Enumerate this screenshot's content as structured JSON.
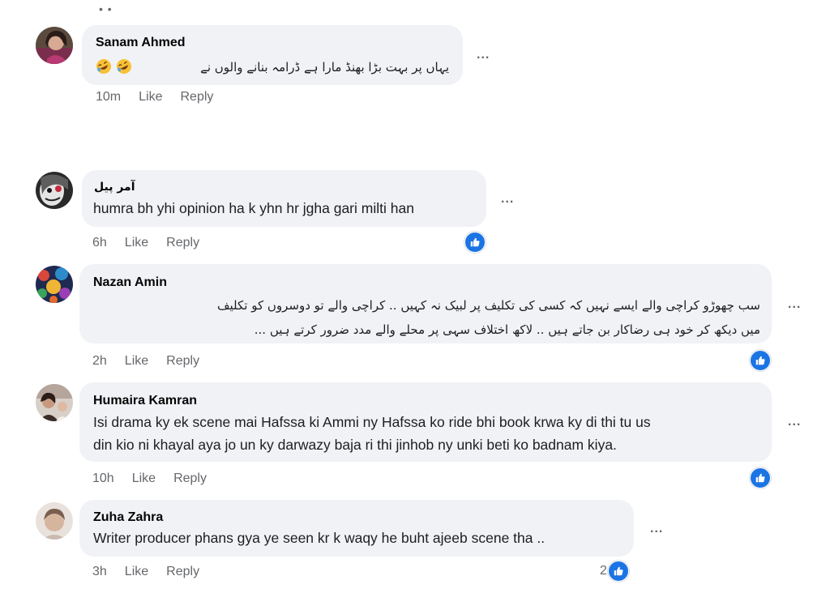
{
  "comments": [
    {
      "author": "Sanam Ahmed",
      "text": "یہاں پر بہت بڑا بھنڈ مارا ہے ڈرامہ بنانے والوں نے",
      "emojis": [
        "rolling-on-floor-laughing-icon",
        "rolling-on-floor-laughing-icon"
      ],
      "time": "10m",
      "like_label": "Like",
      "reply_label": "Reply"
    },
    {
      "author": "آمر پیل",
      "text": "humra bh yhi opinion ha k yhn hr jgha gari milti han",
      "time": "6h",
      "like_label": "Like",
      "reply_label": "Reply",
      "reaction": "like"
    },
    {
      "author": "Nazan Amin",
      "text_lines": [
        "سب چھوڑو کراچی والے ایسے نہیں کہ کسی کی تکلیف پر لبیک نہ کہیں .. کراچی والے تو دوسروں کو تکلیف",
        "میں دیکھ کر خود ہی رضاکار بن جاتے ہیں .. لاکھ اختلاف سہی پر محلے والے مدد ضرور کرتے ہیں ..."
      ],
      "time": "2h",
      "like_label": "Like",
      "reply_label": "Reply",
      "reaction": "like"
    },
    {
      "author": "Humaira Kamran",
      "text_lines": [
        "Isi drama ky ek scene mai Hafssa ki Ammi ny Hafssa ko ride bhi book krwa ky di thi tu us",
        "din kio ni khayal aya jo un ky darwazy baja ri thi jinhob ny unki beti ko badnam kiya."
      ],
      "time": "10h",
      "like_label": "Like",
      "reply_label": "Reply",
      "reaction": "like"
    },
    {
      "author": "Zuha Zahra",
      "text": "Writer producer phans gya ye seen kr k waqy he buht ajeeb scene tha ..",
      "time": "3h",
      "like_label": "Like",
      "reply_label": "Reply",
      "reaction": "like",
      "reaction_count": "2"
    }
  ],
  "more_label": "...",
  "top_dots": "• •",
  "colors": {
    "bubble": "#f0f2f5",
    "meta": "#65676b",
    "like_blue": "#1b74e4"
  }
}
